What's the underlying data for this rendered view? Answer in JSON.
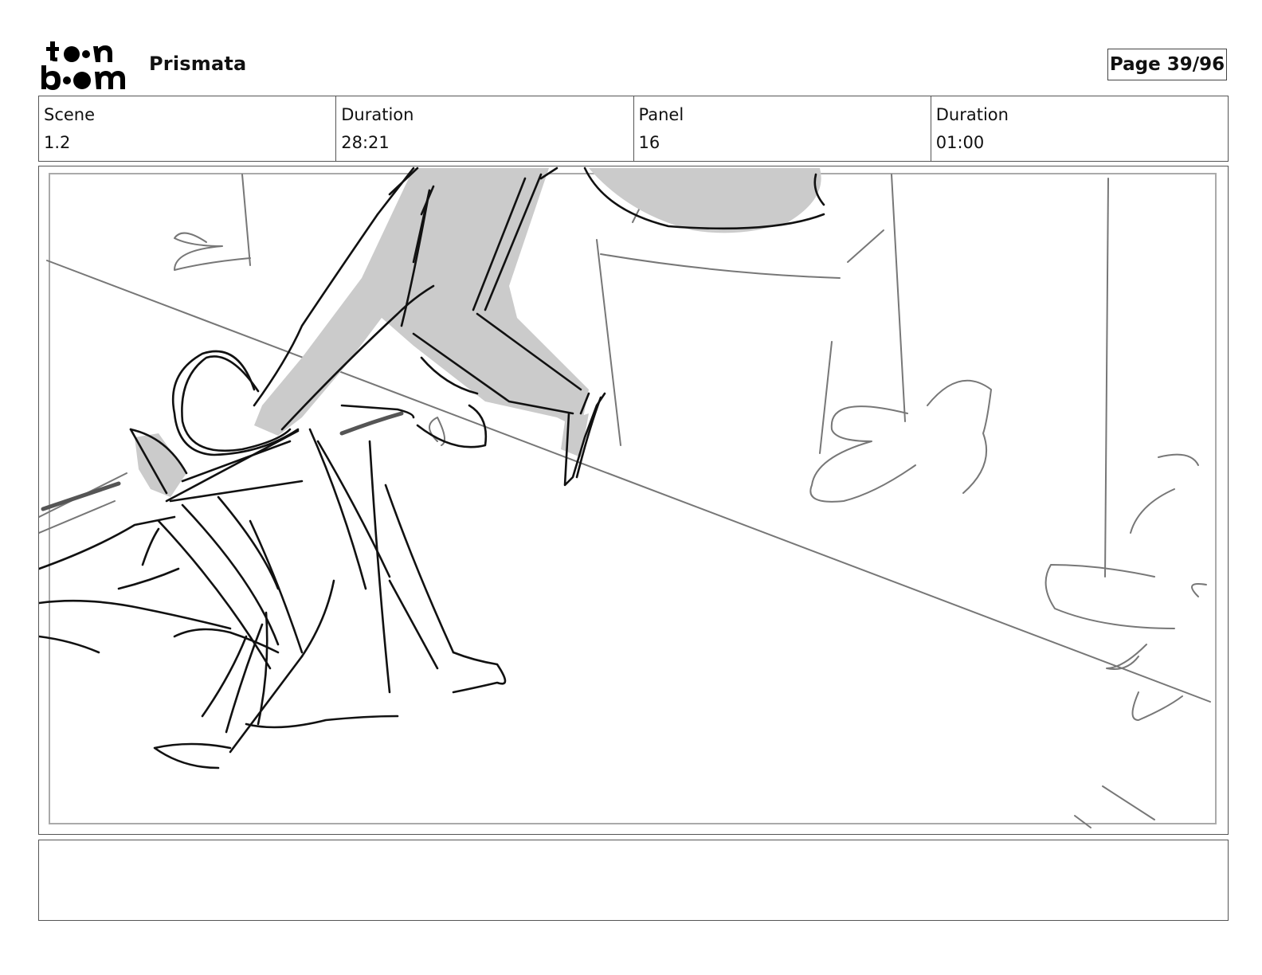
{
  "header": {
    "logo_text": "toon boom",
    "project_title": "Prismata",
    "page_label": "Page 39/96"
  },
  "info": {
    "scene_label": "Scene",
    "scene_value": "1.2",
    "scene_duration_label": "Duration",
    "scene_duration_value": "28:21",
    "panel_label": "Panel",
    "panel_value": "16",
    "panel_duration_label": "Duration",
    "panel_duration_value": "01:00"
  },
  "notes": {
    "text": ""
  }
}
